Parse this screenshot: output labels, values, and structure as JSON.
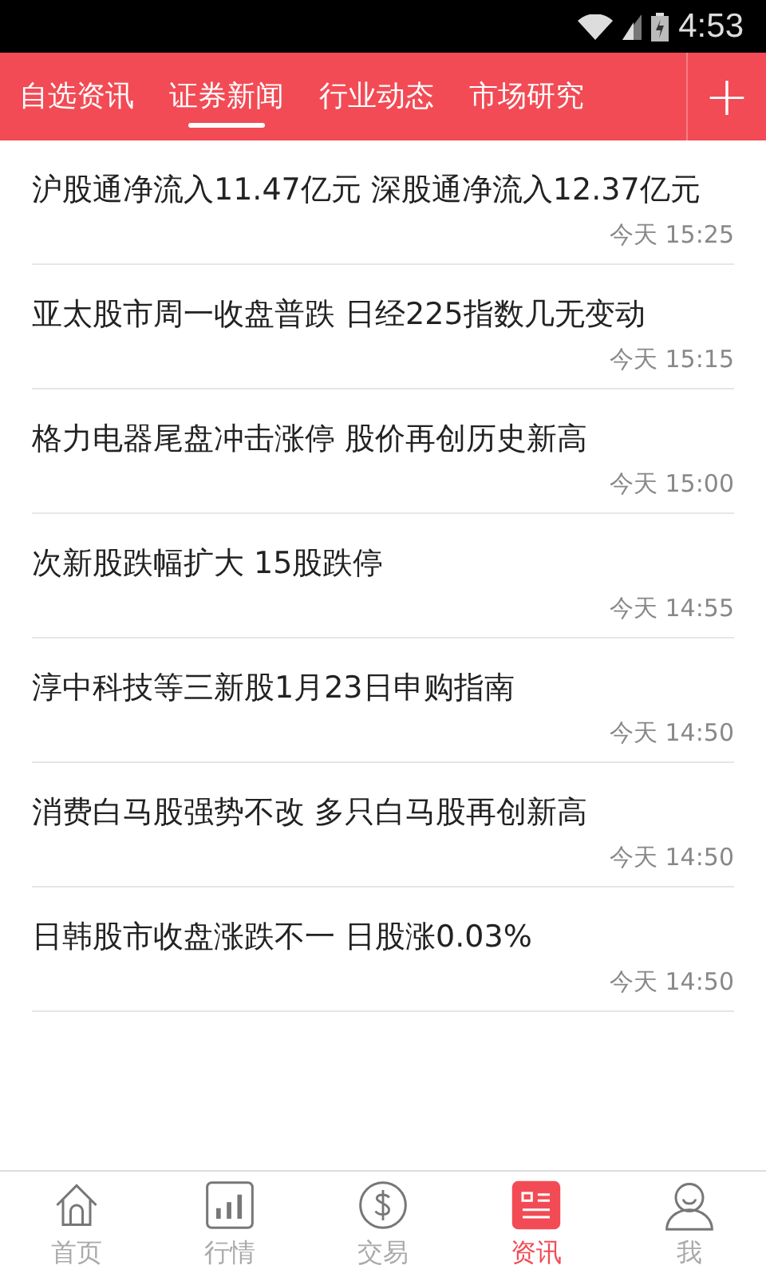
{
  "status_bar": {
    "time": "4:53"
  },
  "tabs": [
    {
      "label": "自选资讯",
      "selected": false
    },
    {
      "label": "证券新闻",
      "selected": true
    },
    {
      "label": "行业动态",
      "selected": false
    },
    {
      "label": "市场研究",
      "selected": false
    }
  ],
  "add_button": "+",
  "news": [
    {
      "title": "沪股通净流入11.47亿元 深股通净流入12.37亿元",
      "time": "今天 15:25"
    },
    {
      "title": "亚太股市周一收盘普跌 日经225指数几无变动",
      "time": "今天 15:15"
    },
    {
      "title": "格力电器尾盘冲击涨停 股价再创历史新高",
      "time": "今天 15:00"
    },
    {
      "title": "次新股跌幅扩大 15股跌停",
      "time": "今天 14:55"
    },
    {
      "title": "淳中科技等三新股1月23日申购指南",
      "time": "今天 14:50"
    },
    {
      "title": "消费白马股强势不改 多只白马股再创新高",
      "time": "今天 14:50"
    },
    {
      "title": "日韩股市收盘涨跌不一 日股涨0.03%",
      "time": "今天 14:50"
    }
  ],
  "bottom_nav": [
    {
      "label": "首页",
      "kind": "home",
      "selected": false
    },
    {
      "label": "行情",
      "kind": "chart",
      "selected": false
    },
    {
      "label": "交易",
      "kind": "trade",
      "selected": false
    },
    {
      "label": "资讯",
      "kind": "news",
      "selected": true
    },
    {
      "label": "我",
      "kind": "me",
      "selected": false
    }
  ]
}
